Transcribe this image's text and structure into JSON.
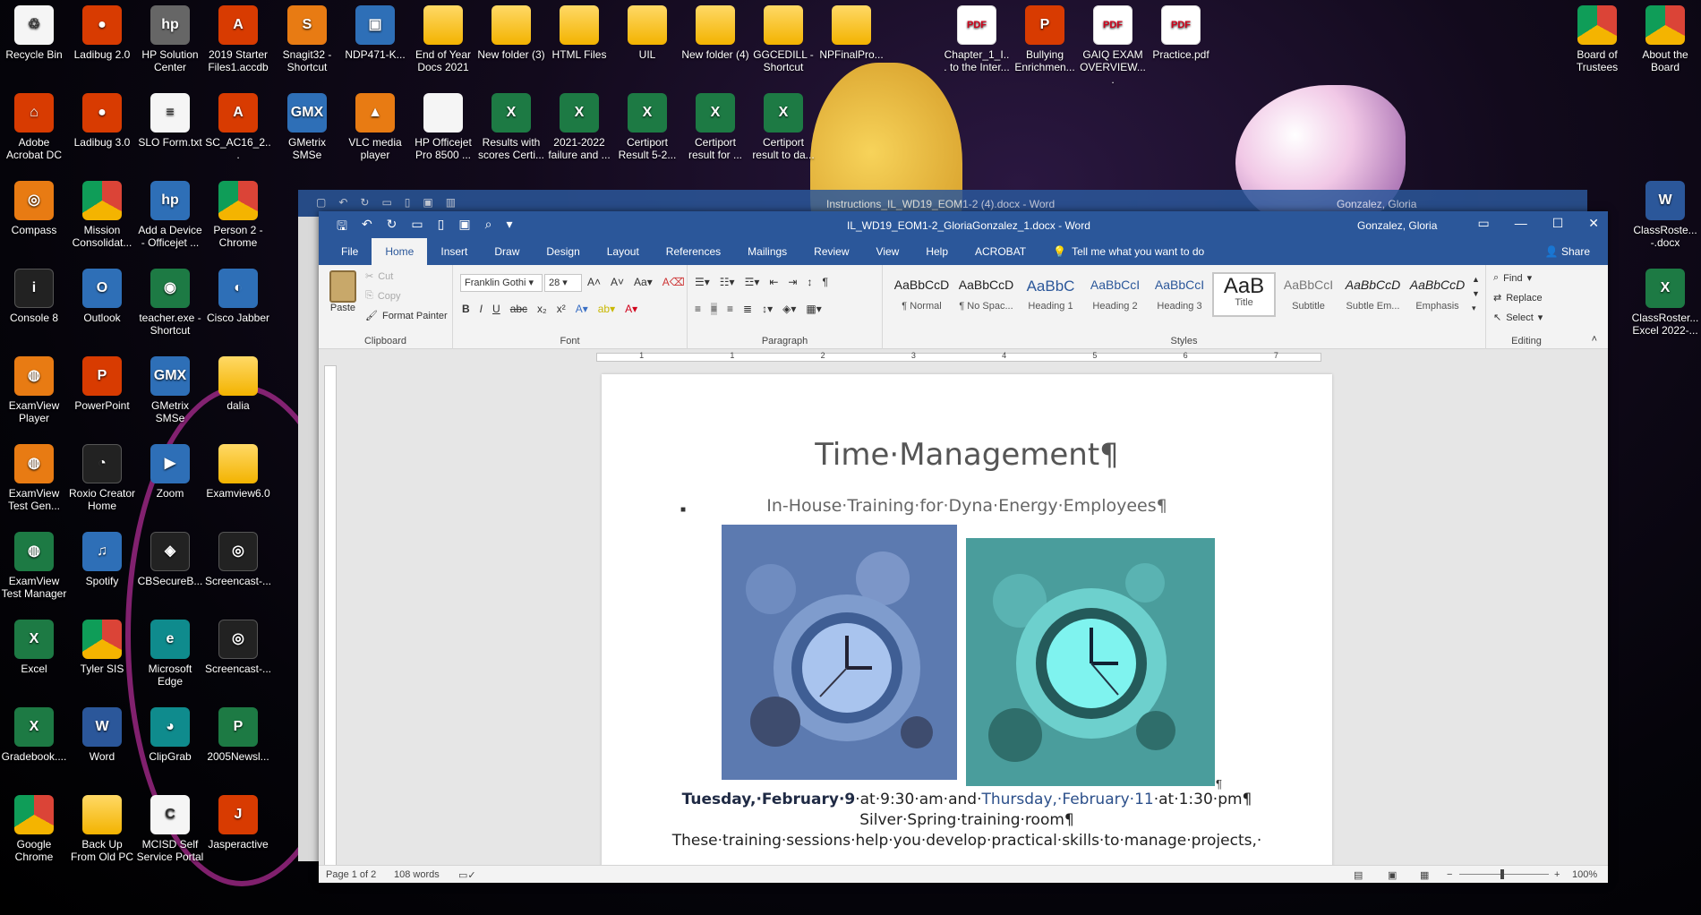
{
  "desktop_left": [
    {
      "label": "Recycle Bin",
      "icon": "recycle-bin-icon",
      "glyph": "♲",
      "style": "g-white"
    },
    {
      "label": "Ladibug 2.0",
      "icon": "ladybug-icon",
      "glyph": "●",
      "style": "g-red"
    },
    {
      "label": "HP Solution Center",
      "icon": "hp-icon",
      "glyph": "hp",
      "style": "g-gray"
    },
    {
      "label": "2019 Starter Files1.accdb",
      "icon": "access-file-icon",
      "glyph": "A",
      "style": "g-red"
    },
    {
      "label": "Snagit32 - Shortcut",
      "icon": "snagit-icon",
      "glyph": "S",
      "style": "g-orange"
    },
    {
      "label": "NDP471-K...",
      "icon": "installer-icon",
      "glyph": "▣",
      "style": "g-app"
    },
    {
      "label": "End of Year Docs 2021",
      "icon": "folder-icon",
      "glyph": "",
      "style": "g-folder"
    },
    {
      "label": "New folder (3)",
      "icon": "folder-icon",
      "glyph": "",
      "style": "g-folder"
    },
    {
      "label": "HTML Files",
      "icon": "folder-icon",
      "glyph": "",
      "style": "g-folder"
    },
    {
      "label": "UIL",
      "icon": "folder-icon",
      "glyph": "",
      "style": "g-folder"
    },
    {
      "label": "New folder (4)",
      "icon": "folder-icon",
      "glyph": "",
      "style": "g-folder"
    },
    {
      "label": "GGCEDILL - Shortcut",
      "icon": "folder-icon",
      "glyph": "",
      "style": "g-folder"
    },
    {
      "label": "NPFinalPro...",
      "icon": "folder-icon",
      "glyph": "",
      "style": "g-folder"
    },
    {
      "label": "Chapter_1_I... to the Inter...",
      "icon": "pdf-icon",
      "glyph": "PDF",
      "style": "g-pdf"
    },
    {
      "label": "Bullying Enrichmen...",
      "icon": "powerpoint-file-icon",
      "glyph": "P",
      "style": "g-red"
    },
    {
      "label": "GAIQ EXAM OVERVIEW....",
      "icon": "pdf-icon",
      "glyph": "PDF",
      "style": "g-pdf"
    },
    {
      "label": "Practice.pdf",
      "icon": "pdf-icon",
      "glyph": "PDF",
      "style": "g-pdf"
    },
    {
      "label": "Adobe Acrobat DC",
      "icon": "acrobat-icon",
      "glyph": "⌂",
      "style": "g-red"
    },
    {
      "label": "Ladibug 3.0",
      "icon": "ladybug-icon",
      "glyph": "●",
      "style": "g-red"
    },
    {
      "label": "SLO Form.txt",
      "icon": "text-file-icon",
      "glyph": "≡",
      "style": "g-white"
    },
    {
      "label": "SC_AC16_2...",
      "icon": "access-file-icon",
      "glyph": "A",
      "style": "g-red"
    },
    {
      "label": "GMetrix SMSe",
      "icon": "gmetrix-icon",
      "glyph": "GMX",
      "style": "g-app"
    },
    {
      "label": "VLC media player",
      "icon": "vlc-icon",
      "glyph": "▲",
      "style": "g-orange"
    },
    {
      "label": "HP Officejet Pro 8500 ...",
      "icon": "document-icon",
      "glyph": "",
      "style": "g-white"
    },
    {
      "label": "Results with scores Certi...",
      "icon": "excel-file-icon",
      "glyph": "X",
      "style": "g-excel"
    },
    {
      "label": "2021-2022 failure and ...",
      "icon": "excel-file-icon",
      "glyph": "X",
      "style": "g-excel"
    },
    {
      "label": "Certiport Result 5-2...",
      "icon": "excel-file-icon",
      "glyph": "X",
      "style": "g-excel"
    },
    {
      "label": "Certiport result for ...",
      "icon": "excel-file-icon",
      "glyph": "X",
      "style": "g-excel"
    },
    {
      "label": "Certiport result to da...",
      "icon": "excel-file-icon",
      "glyph": "X",
      "style": "g-excel"
    },
    {
      "label": "Compass",
      "icon": "compass-icon",
      "glyph": "◎",
      "style": "g-orange"
    },
    {
      "label": "Mission Consolidat...",
      "icon": "chrome-icon",
      "glyph": "",
      "style": "g-chrome"
    },
    {
      "label": "Add a Device - Officejet ...",
      "icon": "hp-icon",
      "glyph": "hp",
      "style": "g-app"
    },
    {
      "label": "Person 2 - Chrome",
      "icon": "chrome-icon",
      "glyph": "",
      "style": "g-chrome"
    },
    {
      "label": "Console 8",
      "icon": "console-icon",
      "glyph": "i",
      "style": "g-dark"
    },
    {
      "label": "Outlook",
      "icon": "outlook-icon",
      "glyph": "O",
      "style": "g-app"
    },
    {
      "label": "teacher.exe - Shortcut",
      "icon": "teacher-app-icon",
      "glyph": "◉",
      "style": "g-excel"
    },
    {
      "label": "Cisco Jabber",
      "icon": "jabber-icon",
      "glyph": "◐",
      "style": "g-app"
    },
    {
      "label": "ExamView Player",
      "icon": "examview-icon",
      "glyph": "◍",
      "style": "g-orange"
    },
    {
      "label": "PowerPoint",
      "icon": "powerpoint-icon",
      "glyph": "P",
      "style": "g-red"
    },
    {
      "label": "GMetrix SMSe",
      "icon": "gmetrix-icon",
      "glyph": "GMX",
      "style": "g-app"
    },
    {
      "label": "dalia",
      "icon": "folder-icon",
      "glyph": "",
      "style": "g-folder"
    },
    {
      "label": "ExamView Test Gen...",
      "icon": "examview-icon",
      "glyph": "◍",
      "style": "g-orange"
    },
    {
      "label": "Roxio Creator Home",
      "icon": "roxio-icon",
      "glyph": "◔",
      "style": "g-dark"
    },
    {
      "label": "Zoom",
      "icon": "zoom-icon",
      "glyph": "▶",
      "style": "g-app"
    },
    {
      "label": "Examview6.0",
      "icon": "folder-icon",
      "glyph": "",
      "style": "g-folder"
    },
    {
      "label": "ExamView Test Manager",
      "icon": "examview-icon",
      "glyph": "◍",
      "style": "g-excel"
    },
    {
      "label": "Spotify",
      "icon": "spotify-icon",
      "glyph": "♫",
      "style": "g-app"
    },
    {
      "label": "CBSecureB...",
      "icon": "cbsecure-icon",
      "glyph": "◈",
      "style": "g-dark"
    },
    {
      "label": "Screencast-...",
      "icon": "screencast-icon",
      "glyph": "◎",
      "style": "g-dark"
    },
    {
      "label": "Excel",
      "icon": "excel-icon",
      "glyph": "X",
      "style": "g-excel"
    },
    {
      "label": "Tyler SIS",
      "icon": "chrome-icon",
      "glyph": "",
      "style": "g-chrome"
    },
    {
      "label": "Microsoft Edge",
      "icon": "edge-icon",
      "glyph": "e",
      "style": "g-teal"
    },
    {
      "label": "Screencast-...",
      "icon": "screencast-icon",
      "glyph": "◎",
      "style": "g-dark"
    },
    {
      "label": "Gradebook....",
      "icon": "excel-file-icon",
      "glyph": "X",
      "style": "g-excel"
    },
    {
      "label": "Word",
      "icon": "word-icon",
      "glyph": "W",
      "style": "g-word"
    },
    {
      "label": "ClipGrab",
      "icon": "clipgrab-icon",
      "glyph": "◕",
      "style": "g-teal"
    },
    {
      "label": "2005Newsl...",
      "icon": "publisher-file-icon",
      "glyph": "P",
      "style": "g-excel"
    },
    {
      "label": "Google Chrome",
      "icon": "chrome-icon",
      "glyph": "",
      "style": "g-chrome"
    },
    {
      "label": "Back Up From Old PC",
      "icon": "folder-icon",
      "glyph": "",
      "style": "g-folder"
    },
    {
      "label": "MCISD Self Service Portal",
      "icon": "portal-icon",
      "glyph": "C",
      "style": "g-white"
    },
    {
      "label": "Jasperactive",
      "icon": "jasperactive-icon",
      "glyph": "J",
      "style": "g-red"
    }
  ],
  "desktop_right": [
    {
      "label": "Board of Trustees",
      "icon": "globe-icon",
      "glyph": "",
      "style": "g-chrome"
    },
    {
      "label": "About the Board",
      "icon": "chrome-icon",
      "glyph": "",
      "style": "g-chrome"
    },
    {
      "label": "ClassRoste... -.docx",
      "icon": "word-file-icon",
      "glyph": "W",
      "style": "g-word"
    },
    {
      "label": "ClassRoster... Excel 2022-...",
      "icon": "excel-file-icon",
      "glyph": "X",
      "style": "g-excel"
    }
  ],
  "back_window": {
    "title": "Instructions_IL_WD19_EOM1-2 (4).docx  -  Word",
    "user": "Gonzalez, Gloria"
  },
  "word": {
    "title": "IL_WD19_EOM1-2_GloriaGonzalez_1.docx  -  Word",
    "user": "Gonzalez, Gloria",
    "tabs": [
      "File",
      "Home",
      "Insert",
      "Draw",
      "Design",
      "Layout",
      "References",
      "Mailings",
      "Review",
      "View",
      "Help",
      "ACROBAT"
    ],
    "tell_me": "Tell me what you want to do",
    "share": "Share",
    "clipboard": {
      "paste": "Paste",
      "cut": "Cut",
      "copy": "Copy",
      "format_painter": "Format Painter",
      "group": "Clipboard"
    },
    "font": {
      "name": "Franklin Gothi",
      "size": "28",
      "group": "Font"
    },
    "paragraph": {
      "group": "Paragraph"
    },
    "styles": {
      "group": "Styles",
      "items": [
        {
          "sample": "AaBbCcD",
          "name": "¶ Normal"
        },
        {
          "sample": "AaBbCcD",
          "name": "¶ No Spac..."
        },
        {
          "sample": "AaBbC",
          "name": "Heading 1"
        },
        {
          "sample": "AaBbCcI",
          "name": "Heading 2"
        },
        {
          "sample": "AaBbCcI",
          "name": "Heading 3"
        },
        {
          "sample": "AaB",
          "name": "Title"
        },
        {
          "sample": "AaBbCcI",
          "name": "Subtitle"
        },
        {
          "sample": "AaBbCcD",
          "name": "Subtle Em..."
        },
        {
          "sample": "AaBbCcD",
          "name": "Emphasis"
        }
      ]
    },
    "editing": {
      "group": "Editing",
      "find": "Find",
      "replace": "Replace",
      "select": "Select"
    },
    "ruler_nums": [
      "1",
      "1",
      "2",
      "3",
      "4",
      "5",
      "6",
      "7"
    ],
    "doc": {
      "title": "Time·Management¶",
      "subtitle": "In-House·Training·for·Dyna·Energy·Employees¶",
      "line1a": "Tuesday,·February·9",
      "line1b": "·at·9:30·am·and·",
      "line1c": "Thursday,·February·11",
      "line1d": "·at·1:30·pm¶",
      "line2": "Silver·Spring·training·room¶",
      "line3": "These·training·sessions·help·you·develop·practical·skills·to·manage·projects,·"
    },
    "status": {
      "page": "Page 1 of 2",
      "words": "108 words",
      "zoom": "100%"
    }
  }
}
